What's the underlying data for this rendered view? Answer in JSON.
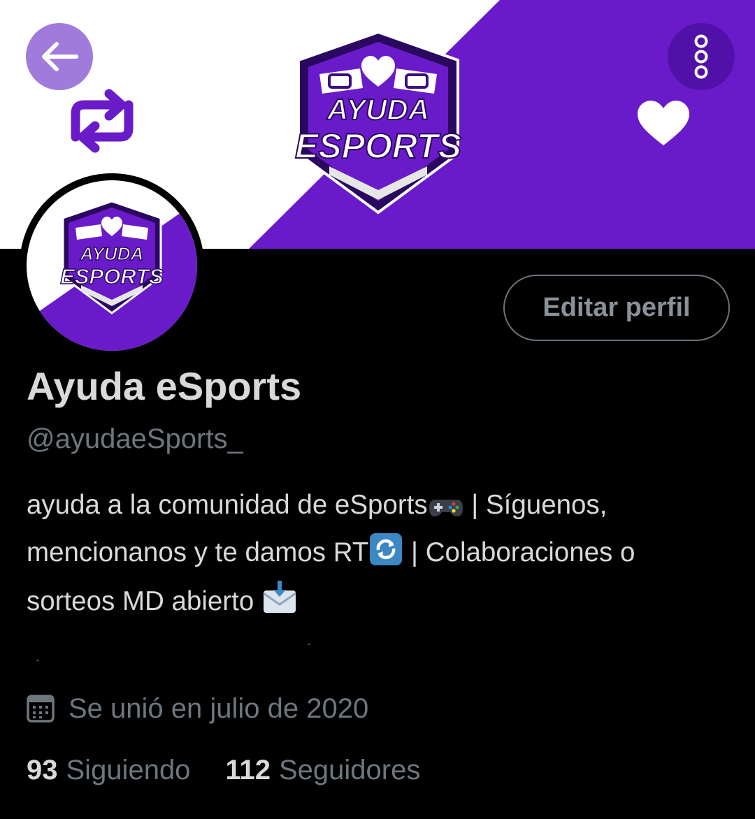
{
  "profile": {
    "display_name": "Ayuda eSports",
    "handle": "@ayudaeSports_",
    "edit_label": "Editar perfil",
    "bio": {
      "line1_text": "ayuda a la comunidad de eSports",
      "line1_rest": " | Síguenos,",
      "line2_text": "mencionanos y te damos RT",
      "line2_rest": " | Colaboraciones o",
      "line3_text": "sorteos MD abierto "
    },
    "joined": "Se unió en julio de 2020",
    "following_count": "93",
    "following_label": "Siguiendo",
    "followers_count": "112",
    "followers_label": "Seguidores"
  },
  "logo": {
    "line1": "AYUDA",
    "line2": "ESPORTS"
  },
  "icons": {
    "back": "arrow-left-icon",
    "more": "more-vertical-icon",
    "retweet": "retweet-icon",
    "heart": "heart-icon",
    "calendar": "calendar-icon",
    "bio_gamepad": "gamepad-emoji",
    "bio_refresh": "refresh-emoji",
    "bio_envelope": "incoming-envelope-emoji"
  },
  "colors": {
    "brand_purple": "#6a1bc9",
    "dark_purple": "#3d0e84",
    "back_button": "#a07bdb",
    "text_primary": "#d9d9d9",
    "text_secondary": "#6e767d"
  }
}
